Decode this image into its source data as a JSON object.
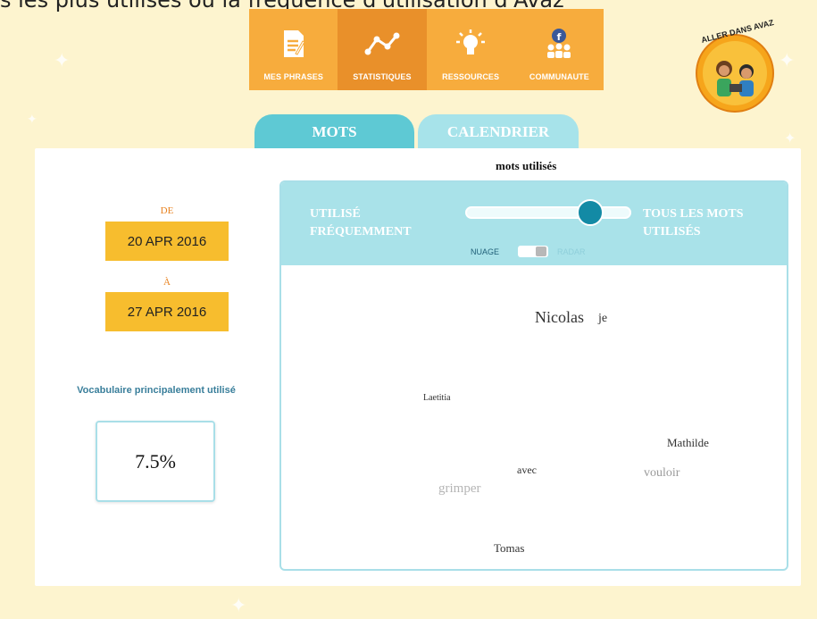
{
  "caption": "s les plus utilisés ou la fréquence d'utilisation d'Avaz",
  "menu": [
    {
      "label": "MES PHRASES",
      "icon": "document-icon",
      "active": false
    },
    {
      "label": "STATISTIQUES",
      "icon": "chart-line-icon",
      "active": true
    },
    {
      "label": "RESSOURCES",
      "icon": "lightbulb-icon",
      "active": false
    },
    {
      "label": "COMMUNAUTE",
      "icon": "community-icon",
      "active": false
    }
  ],
  "logo": {
    "text": "ALLER DANS AVAZ"
  },
  "tabs": {
    "mots": "MOTS",
    "calendrier": "CALENDRIER"
  },
  "chart_title": "mots utilisés",
  "dates": {
    "from_label": "DE",
    "from_value": "20 APR 2016",
    "to_label": "À",
    "to_value": "27 APR 2016"
  },
  "vocab": {
    "label": "Vocabulaire principalement utilisé",
    "value": "7.5%"
  },
  "controls": {
    "left_label_1": "UTILISÉ",
    "left_label_2": "FRÉQUEMMENT",
    "right_label_1": "TOUS LES MOTS",
    "right_label_2": "UTILISÉS",
    "slider_value": 0.75,
    "toggle_left": "NUAGE",
    "toggle_right": "RADAR"
  },
  "words": [
    {
      "text": "Nicolas",
      "color": "#333333"
    },
    {
      "text": "je",
      "color": "#333333"
    },
    {
      "text": "Laetitia",
      "color": "#333333"
    },
    {
      "text": "Mathilde",
      "color": "#333333"
    },
    {
      "text": "avec",
      "color": "#333333"
    },
    {
      "text": "vouloir",
      "color": "#9a9a9a"
    },
    {
      "text": "grimper",
      "color": "#b5b5b5"
    },
    {
      "text": "Tomas",
      "color": "#333333"
    }
  ],
  "colors": {
    "menu_bg": "#f7ac3d",
    "menu_active": "#e9902a",
    "tab_active": "#5ec9d4",
    "tab_inactive": "#a7e3ea",
    "date_box": "#f7bd2e",
    "control_bar": "#a9e2e9",
    "slider_thumb": "#138aa5"
  }
}
